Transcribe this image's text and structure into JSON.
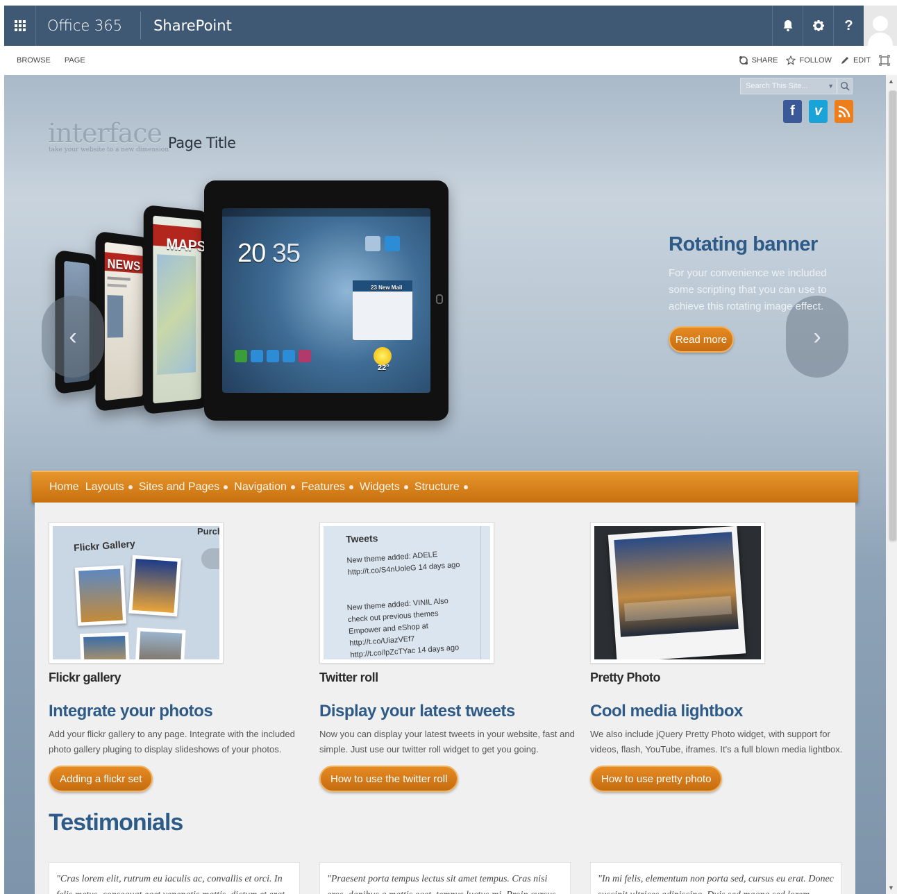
{
  "suitebar": {
    "brand": "Office 365",
    "app": "SharePoint",
    "help": "?"
  },
  "ribbon": {
    "tabs": [
      "BROWSE",
      "PAGE"
    ],
    "share": "SHARE",
    "follow": "FOLLOW",
    "edit": "EDIT"
  },
  "search": {
    "placeholder": "Search This Site..."
  },
  "social": {
    "facebook": "f",
    "vimeo": "v"
  },
  "site": {
    "logo": "interface",
    "tagline": "take your website to a new dimension",
    "page_title": "Page Title"
  },
  "banner": {
    "tablet_labels": {
      "news": "NEWS",
      "maps": "MAPS",
      "clock_hour": "20",
      "clock_min": "35",
      "mail": "23 New Mail",
      "temp": "22°"
    },
    "title": "Rotating banner",
    "text": "For your convenience we included some scripting that you can use to achieve this rotating image effect.",
    "button": "Read more",
    "prev": "‹",
    "next": "›"
  },
  "nav": {
    "items": [
      "Home",
      "Layouts",
      "Sites and Pages",
      "Navigation",
      "Features",
      "Widgets",
      "Structure"
    ]
  },
  "features": [
    {
      "caption": "Flickr gallery",
      "heading": "Integrate your photos",
      "body": "Add your flickr gallery to any page. Integrate with the included photo gallery pluging to display slideshows of your photos.",
      "button": "Adding a flickr set",
      "thumb_title": "Flickr Gallery",
      "thumb_side": "Purch"
    },
    {
      "caption": "Twitter roll",
      "heading": "Display your latest tweets",
      "body": "Now you can display your latest tweets in your website, fast and simple. Just use our twitter roll widget to get you going.",
      "button": "How to use the twitter roll",
      "thumb_title": "Tweets",
      "tweet1": "New theme added: ADELE http://t.co/S4nUoleG 14 days ago",
      "tweet2": "New theme added: VINIL Also check out previous themes Empower and eShop at http://t.co/UiazVEf7 http://t.co/lpZcTYac 14 days ago"
    },
    {
      "caption": "Pretty Photo",
      "heading": "Cool media lightbox",
      "body": "We also include jQuery Pretty Photo widget, with support for videos, flash, YouTube, iframes. It's a full blown media lightbox.",
      "button": "How to use pretty photo"
    }
  ],
  "testimonials": {
    "title": "Testimonials",
    "quotes": [
      "\"Cras lorem elit, rutrum eu iaculis ac, convallis et orci. In felis metus, consequat eget venenatis mattis, dictum et erat. Aliquam erat volutpat. Curabitur quis justo a sapien",
      "\"Praesent porta tempus lectus sit amet tempus. Cras nisi eros, dapibus a mattis eget, tempus luctus mi. Proin cursus bibendum ipsum. Curabitur pulvinar volutpat ornare.",
      "\"In mi felis, elementum non porta sed, cursus eu erat. Donec suscipit ultrices adipiscing. Duis sed magna sed lorem pellentesque dapibus. Integer consequat dapibus in turpis."
    ]
  },
  "colors": {
    "suitebar": "#3f5873",
    "accent_blue": "#2e5a88",
    "orange": "#d57d18",
    "facebook": "#3b5998",
    "vimeo": "#1aa3d8",
    "rss": "#ee7d1a"
  }
}
